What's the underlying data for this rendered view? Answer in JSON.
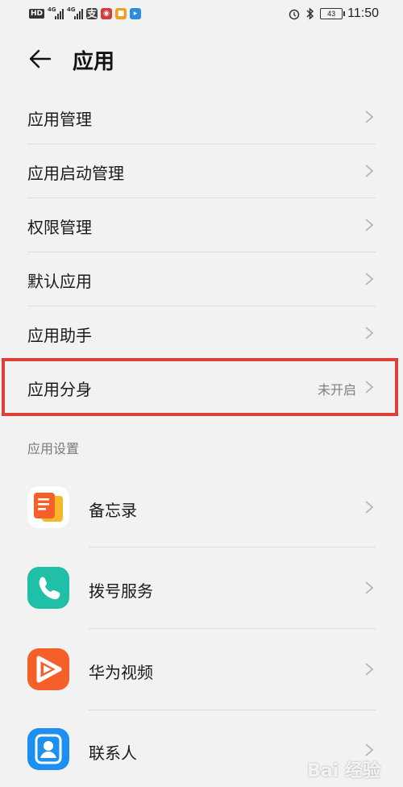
{
  "status_bar": {
    "network_gen_1": "4G",
    "network_gen_2": "4G",
    "hd_label": "HD",
    "battery": "43",
    "time": "11:50"
  },
  "header": {
    "title": "应用"
  },
  "menu": {
    "items": [
      {
        "label": "应用管理"
      },
      {
        "label": "应用启动管理"
      },
      {
        "label": "权限管理"
      },
      {
        "label": "默认应用"
      },
      {
        "label": "应用助手"
      },
      {
        "label": "应用分身",
        "status": "未开启"
      }
    ]
  },
  "section": {
    "label": "应用设置"
  },
  "apps": [
    {
      "label": "备忘录",
      "icon": "memo-icon"
    },
    {
      "label": "拨号服务",
      "icon": "phone-icon"
    },
    {
      "label": "华为视频",
      "icon": "video-icon"
    },
    {
      "label": "联系人",
      "icon": "contacts-icon"
    }
  ],
  "colors": {
    "highlight": "#e0403a",
    "phone": "#1fbfa8",
    "video": "#f5602a",
    "contacts": "#1d8ff0",
    "memo": "#f58a2a"
  },
  "watermark": "Bai 经验"
}
